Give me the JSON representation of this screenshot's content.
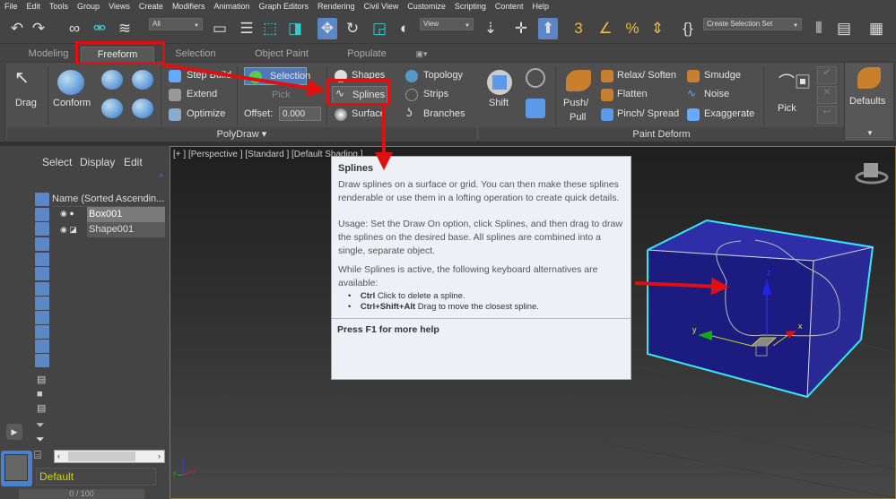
{
  "menu": [
    "File",
    "Edit",
    "Tools",
    "Group",
    "Views",
    "Create",
    "Modifiers",
    "Animation",
    "Graph Editors",
    "Rendering",
    "Civil View",
    "Customize",
    "Scripting",
    "Content",
    "Help"
  ],
  "toolbar": {
    "selection_filter": "All",
    "ref_coord": "View",
    "selection_set": "Create Selection Set"
  },
  "tabs": [
    "Modeling",
    "Freeform",
    "Selection",
    "Object Paint",
    "Populate"
  ],
  "active_tab": "Freeform",
  "ribbon": {
    "polydraw": {
      "label": "PolyDraw",
      "drag": "Drag",
      "conform": "Conform",
      "step_build": "Step Build",
      "extend": "Extend",
      "optimize": "Optimize",
      "selection": "Selection",
      "pick": "Pick",
      "offset_label": "Offset:",
      "offset_value": "0.000",
      "shapes": "Shapes",
      "splines": "Splines",
      "surface": "Surface",
      "topology": "Topology",
      "strips": "Strips",
      "branches": "Branches"
    },
    "paint_deform": {
      "label": "Paint Deform",
      "shift": "Shift",
      "push_pull_1": "Push/",
      "push_pull_2": "Pull",
      "relax": "Relax/ Soften",
      "flatten": "Flatten",
      "pinch": "Pinch/ Spread",
      "smudge": "Smudge",
      "noise": "Noise",
      "exaggerate": "Exaggerate",
      "pick": "Pick"
    },
    "defaults": "Defaults"
  },
  "explorer": {
    "menu": [
      "Select",
      "Display",
      "Edit"
    ],
    "column_header": "Name (Sorted Ascendin...",
    "items": [
      "Box001",
      "Shape001"
    ],
    "layer": "Default",
    "frame": "0 / 100"
  },
  "viewport": {
    "label": "[+ ]  [Perspective ]  [Standard ]  [Default Shading ]",
    "axis_x": "x",
    "axis_y": "y",
    "axis_z": "z"
  },
  "tooltip": {
    "title": "Splines",
    "p1": "Draw splines on a surface or grid. You can then make these splines renderable or use them in a lofting operation to create quick details.",
    "p2": "Usage: Set the Draw On option, click Splines, and then drag to draw the splines on the desired base. All splines are combined into a single, separate object.",
    "p3": "While Splines is active, the following keyboard alternatives are available:",
    "b1_key": "Ctrl",
    "b1_text": " Click to delete a spline.",
    "b2_key": "Ctrl+Shift+Alt",
    "b2_text": " Drag to move the closest spline.",
    "footer": "Press F1 for more help"
  },
  "colors": {
    "highlight": "#e01010",
    "accent": "#5b87c6",
    "box": "#2a2a9a",
    "layer_text": "#d4d400"
  }
}
